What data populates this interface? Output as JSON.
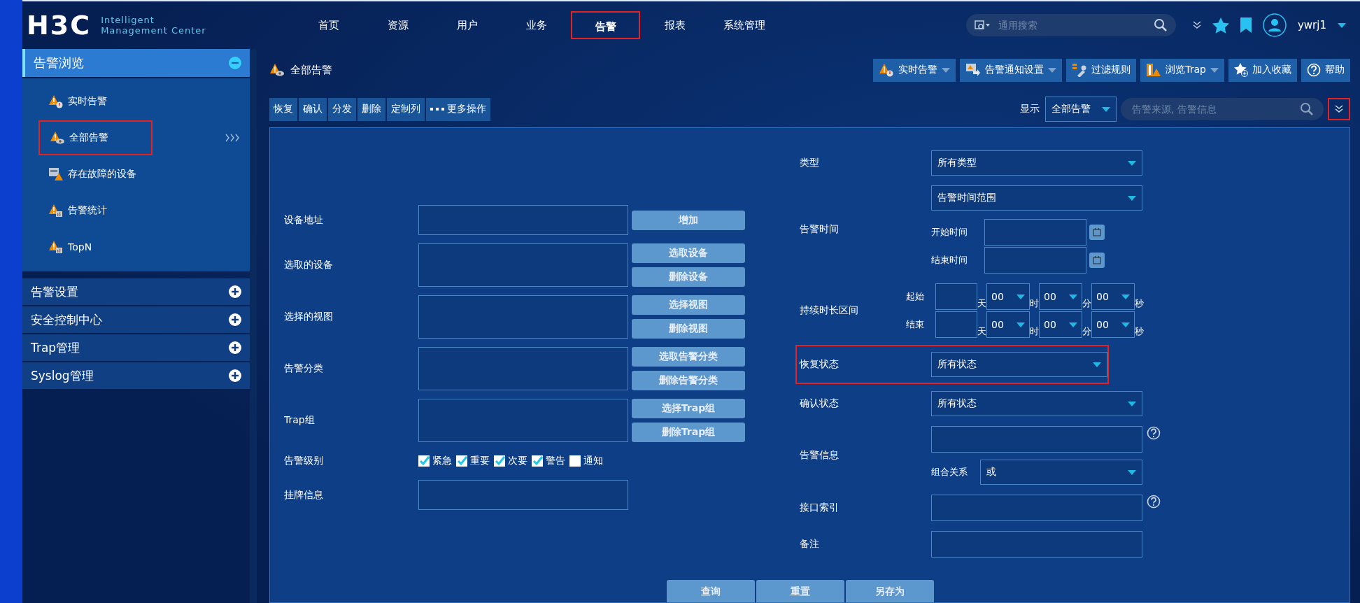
{
  "header": {
    "logo": "H3C",
    "tagline": [
      "Intelligent",
      "Management Center"
    ],
    "nav": [
      {
        "label": "首页",
        "selected": false,
        "highlighted": false
      },
      {
        "label": "资源",
        "selected": false,
        "highlighted": false
      },
      {
        "label": "用户",
        "selected": false,
        "highlighted": false
      },
      {
        "label": "业务",
        "selected": false,
        "highlighted": false
      },
      {
        "label": "告警",
        "selected": true,
        "highlighted": true
      },
      {
        "label": "报表",
        "selected": false,
        "highlighted": false
      },
      {
        "label": "系统管理",
        "selected": false,
        "highlighted": false
      }
    ],
    "search": {
      "placeholder": "通用搜索"
    },
    "user": "ywrj1"
  },
  "sidebar": [
    {
      "label": "告警浏览",
      "expanded": true,
      "items": [
        {
          "label": "实时告警",
          "kind": "clock",
          "selected": false,
          "highlighted": false
        },
        {
          "label": "全部告警",
          "kind": "eye",
          "selected": true,
          "highlighted": true
        },
        {
          "label": "存在故障的设备",
          "kind": "device",
          "selected": false,
          "highlighted": false
        },
        {
          "label": "告警统计",
          "kind": "chart",
          "selected": false,
          "highlighted": false
        },
        {
          "label": "TopN",
          "kind": "chart",
          "selected": false,
          "highlighted": false
        }
      ]
    },
    {
      "label": "告警设置",
      "expanded": false
    },
    {
      "label": "安全控制中心",
      "expanded": false
    },
    {
      "label": "Trap管理",
      "expanded": false
    },
    {
      "label": "Syslog管理",
      "expanded": false
    }
  ],
  "page_title": "全部告警",
  "toolbar": [
    {
      "label": "实时告警",
      "kind": "clock",
      "dropdown": true
    },
    {
      "label": "告警通知设置",
      "kind": "notify",
      "dropdown": true
    },
    {
      "label": "过滤规则",
      "kind": "filter",
      "dropdown": false
    },
    {
      "label": "浏览Trap",
      "kind": "trap",
      "dropdown": true
    },
    {
      "label": "加入收藏",
      "kind": "star",
      "dropdown": false
    },
    {
      "label": "帮助",
      "kind": "help",
      "dropdown": false
    }
  ],
  "actions": [
    {
      "label": "恢复",
      "kind": "plain"
    },
    {
      "label": "确认",
      "kind": "plain"
    },
    {
      "label": "分发",
      "kind": "plain"
    },
    {
      "label": "删除",
      "kind": "plain"
    },
    {
      "label": "定制列",
      "kind": "plain"
    },
    {
      "label": "更多操作",
      "kind": "more"
    }
  ],
  "display": {
    "label": "显示",
    "value": "全部告警"
  },
  "filter_search": {
    "placeholder": "告警来源, 告警信息"
  },
  "expand_button": {
    "highlighted": true
  },
  "form_left": [
    {
      "label": "设备地址",
      "kind": "text",
      "buttons": [
        "增加"
      ]
    },
    {
      "label": "选取的设备",
      "kind": "list",
      "buttons": [
        "选取设备",
        "删除设备"
      ]
    },
    {
      "label": "选择的视图",
      "kind": "list",
      "buttons": [
        "选择视图",
        "删除视图"
      ]
    },
    {
      "label": "告警分类",
      "kind": "list",
      "buttons": [
        "选取告警分类",
        "删除告警分类"
      ]
    },
    {
      "label": "Trap组",
      "kind": "list",
      "buttons": [
        "选择Trap组",
        "删除Trap组"
      ]
    },
    {
      "label": "告警级别",
      "kind": "levels",
      "options": [
        {
          "label": "紧急",
          "checked": true
        },
        {
          "label": "重要",
          "checked": true
        },
        {
          "label": "次要",
          "checked": true
        },
        {
          "label": "警告",
          "checked": true
        },
        {
          "label": "通知",
          "checked": false
        }
      ]
    },
    {
      "label": "挂牌信息",
      "kind": "text"
    }
  ],
  "form_right": [
    {
      "label": "类型",
      "kind": "select",
      "value": "所有类型",
      "highlighted": false
    },
    {
      "label": "告警时间",
      "kind": "time",
      "select": "告警时间范围",
      "fields": [
        "开始时间",
        "结束时间"
      ]
    },
    {
      "label": "持续时长区间",
      "kind": "duration",
      "rows": [
        {
          "label": "起始",
          "units": [
            "天",
            "时",
            "分",
            "秒"
          ],
          "values": [
            "00",
            "00",
            "00"
          ]
        },
        {
          "label": "结束",
          "units": [
            "天",
            "时",
            "分",
            "秒"
          ],
          "values": [
            "00",
            "00",
            "00"
          ]
        }
      ]
    },
    {
      "label": "恢复状态",
      "kind": "select",
      "value": "所有状态",
      "highlighted": true
    },
    {
      "label": "确认状态",
      "kind": "select",
      "value": "所有状态",
      "highlighted": false
    },
    {
      "label": "告警信息",
      "kind": "info",
      "combo_label": "组合关系",
      "combo_value": "或"
    },
    {
      "label": "接口索引",
      "kind": "text",
      "help": true
    },
    {
      "label": "备注",
      "kind": "text",
      "help": false
    }
  ],
  "form_buttons": [
    "查询",
    "重置",
    "另存为"
  ]
}
